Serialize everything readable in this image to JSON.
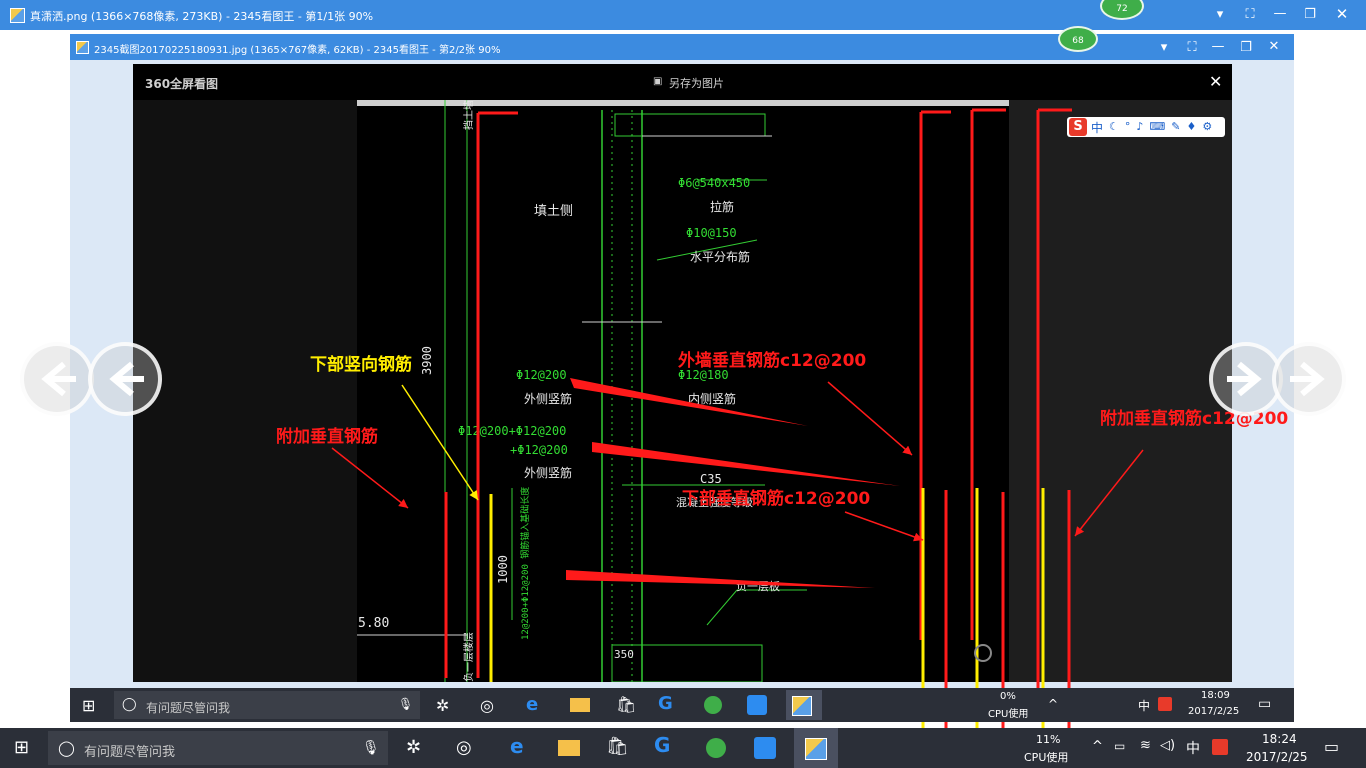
{
  "outer_window": {
    "title": "真潇洒.png (1366×768像素, 273KB) - 2345看图王 - 第1/1张 90%",
    "badge": "72"
  },
  "inner_window": {
    "title": "2345截图20170225180931.jpg (1365×767像素, 62KB) - 2345看图王 - 第2/2张 90%",
    "badge": "68"
  },
  "viewer": {
    "brand": "360全屏看图",
    "save_label": "另存为图片",
    "close_glyph": "✕",
    "ime_logo": "S",
    "ime_mode": "中"
  },
  "cad": {
    "fill_side": "填土侧",
    "tie_spec": "Φ6@540x450",
    "tie_label": "拉筋",
    "horiz_spec": "Φ10@150",
    "horiz_label": "水平分布筋",
    "outer_spec": "Φ12@200",
    "outer_label": "外侧竖筋",
    "inner_spec": "Φ12@180",
    "inner_label": "内侧竖筋",
    "combo_spec": "Φ12@200+Φ12@200",
    "combo_spec2": "+Φ12@200",
    "outer_label2": "外侧竖筋",
    "concrete": "C35",
    "concrete_label": "混凝土强度等级",
    "floor_label": "负一层板",
    "dim_3900": "3900",
    "dim_1000": "1000",
    "elev": "5.80",
    "vert_note": "12@200+Φ12@200 钢筋锚入基础长度",
    "top_label": "挡土墙",
    "bottom_label": "负一层楼层",
    "num_350": "350"
  },
  "annotations": {
    "lower_vertical": "下部竖向钢筋",
    "extra_vertical_left": "附加垂直钢筋",
    "outer_wall_vertical": "外墙垂直钢筋c12@200",
    "lower_vertical_right": "下部垂直钢筋c12@200",
    "extra_vertical_right": "附加垂直钢筋c12@200"
  },
  "inner_taskbar": {
    "search_placeholder": "有问题尽管问我",
    "cpu_percent": "0%",
    "cpu_label": "CPU使用",
    "ime": "中",
    "time": "18:09",
    "date": "2017/2/25"
  },
  "taskbar": {
    "search_placeholder": "有问题尽管问我",
    "cpu_percent": "11%",
    "cpu_label": "CPU使用",
    "ime": "中",
    "time": "18:24",
    "date": "2017/2/25"
  },
  "icons": [
    "app-icon",
    "minimize-icon",
    "maximize-icon",
    "restore-icon",
    "close-icon",
    "chevron-down-icon",
    "fullscreen-icon",
    "prev-arrow-icon",
    "next-arrow-icon",
    "windows-start-icon",
    "cortana-icon",
    "mic-icon",
    "edge-icon",
    "folder-icon",
    "store-icon",
    "notification-icon",
    "save-icon"
  ],
  "colors": {
    "titlebar": "#3c8be0",
    "taskbar": "#2b2f38",
    "red": "#ff1a1a",
    "yellow": "#ffee00",
    "cad_green": "#33dd33"
  }
}
